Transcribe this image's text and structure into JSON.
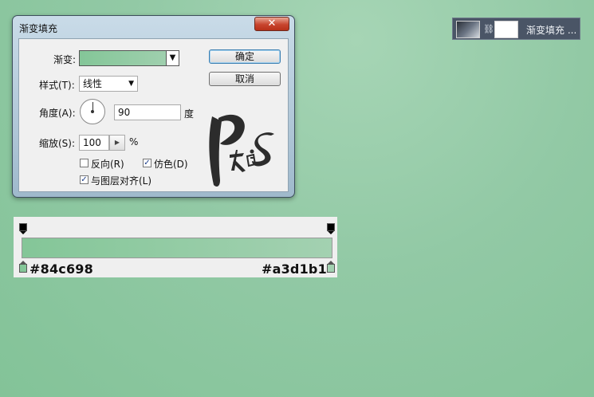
{
  "layer": {
    "name": "渐变填充 ..."
  },
  "dialog": {
    "title": "渐变填充",
    "close_label": "✕",
    "gradient_label": "渐变:",
    "style_label": "样式(T):",
    "style_value": "线性",
    "angle_label": "角度(A):",
    "angle_value": "90",
    "angle_unit": "度",
    "scale_label": "缩放(S):",
    "scale_value": "100",
    "scale_unit": "%",
    "reverse_label": "反向(R)",
    "reverse_checked": false,
    "dither_label": "仿色(D)",
    "dither_checked": true,
    "align_label": "与图层对齐(L)",
    "align_checked": true,
    "ok_label": "确定",
    "cancel_label": "取消"
  },
  "gradient_strip": {
    "left_color": "#84c698",
    "right_color": "#a3d1b1",
    "left_label": "#84c698",
    "right_label": "#a3d1b1"
  }
}
